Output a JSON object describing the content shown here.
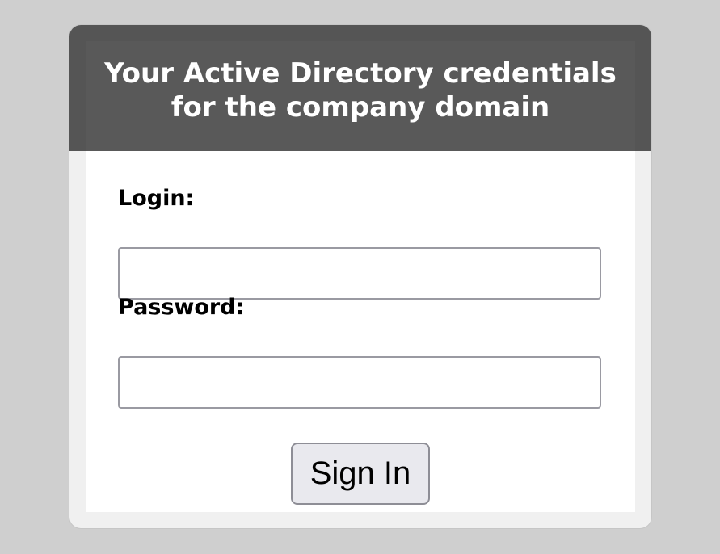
{
  "header": {
    "title": "Your Active Directory credentials for the company domain"
  },
  "form": {
    "login_label": "Login:",
    "login_value": "",
    "password_label": "Password:",
    "password_value": "",
    "submit_label": "Sign In"
  },
  "colors": {
    "page_background": "#cfcfcf",
    "header_background": "#555555",
    "card_background": "#ffffff",
    "button_background": "#e9e9ee"
  }
}
